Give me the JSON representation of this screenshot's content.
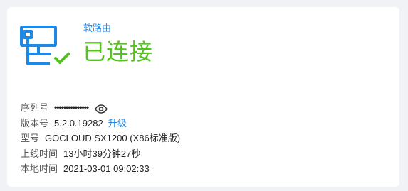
{
  "colors": {
    "accent": "#1e88e5",
    "success": "#52c41a",
    "card_bg": "#ffffff",
    "page_bg": "#f0f2f5"
  },
  "header": {
    "device_type": "软路由",
    "status": "已连接",
    "icon": "router-connected-icon"
  },
  "info": {
    "serial": {
      "label": "序列号",
      "value": "•••••••••••••••",
      "toggle_icon": "eye-icon"
    },
    "version": {
      "label": "版本号",
      "value": "5.2.0.19282",
      "upgrade_link": "升级"
    },
    "model": {
      "label": "型号",
      "value": "GOCLOUD SX1200 (X86标准版)"
    },
    "uptime": {
      "label": "上线时间",
      "value": "13小时39分钟27秒"
    },
    "local_time": {
      "label": "本地时间",
      "value": "2021-03-01 09:02:33"
    }
  }
}
